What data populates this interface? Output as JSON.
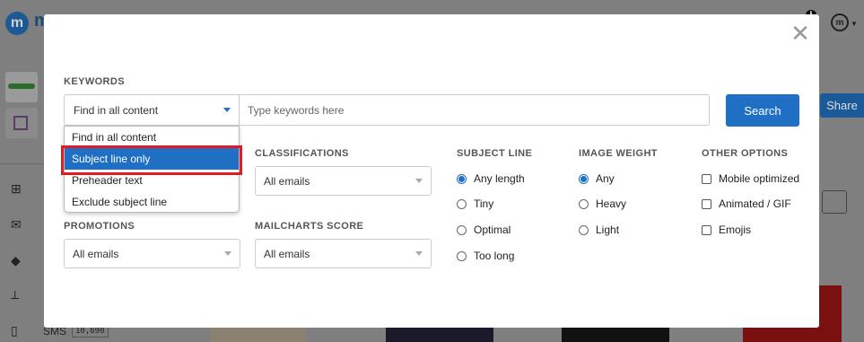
{
  "background": {
    "logo_letter": "m",
    "logo_text": "m",
    "info_icon": "info-icon",
    "user_letter": "m",
    "share_label": "Share",
    "sms_label": "SMS",
    "sms_count": "10,690"
  },
  "modal": {
    "close_symbol": "✕",
    "keywords": {
      "label": "KEYWORDS",
      "scope_selected": "Find in all content",
      "placeholder": "Type keywords here",
      "search_label": "Search",
      "scope_options": [
        "Find in all content",
        "Subject line only",
        "Preheader text",
        "Exclude subject line"
      ],
      "highlighted_option": "Subject line only"
    },
    "classifications": {
      "label": "CLASSIFICATIONS",
      "value": "All emails"
    },
    "promotions": {
      "label": "PROMOTIONS",
      "value": "All emails"
    },
    "mailcharts_score": {
      "label": "MAILCHARTS SCORE",
      "value": "All emails"
    },
    "subject_line": {
      "label": "SUBJECT LINE",
      "options": [
        "Any length",
        "Tiny",
        "Optimal",
        "Too long"
      ],
      "selected": "Any length"
    },
    "image_weight": {
      "label": "IMAGE WEIGHT",
      "options": [
        "Any",
        "Heavy",
        "Light"
      ],
      "selected": "Any"
    },
    "other_options": {
      "label": "OTHER OPTIONS",
      "options": [
        "Mobile optimized",
        "Animated / GIF",
        "Emojis"
      ]
    }
  },
  "colors": {
    "accent": "#1f6fc5",
    "highlight": "#e01b24"
  }
}
